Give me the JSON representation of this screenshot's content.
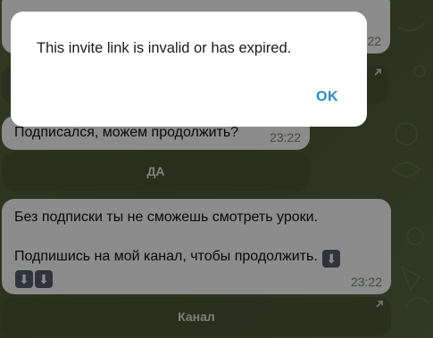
{
  "dialog": {
    "message": "This invite link is invalid or has expired.",
    "ok_label": "OK"
  },
  "messages": [
    {
      "time": "23:22"
    },
    {
      "text": "Подписался, можем продолжить?",
      "time": "23:22"
    },
    {
      "line1": "Без подписки ты не сможешь смотреть уроки.",
      "line2": "Подпишись на мой канал, чтобы продолжить.",
      "time": "23:22"
    }
  ],
  "buttons": {
    "yes_label": "ДА",
    "channel_label": "Канал"
  },
  "icons": {
    "emoji": "down-arrow-emoji-icon",
    "link_arrow": "external-link-arrow-icon"
  },
  "colors": {
    "accent": "#2a8bcc",
    "background": "#5c6a3f"
  }
}
